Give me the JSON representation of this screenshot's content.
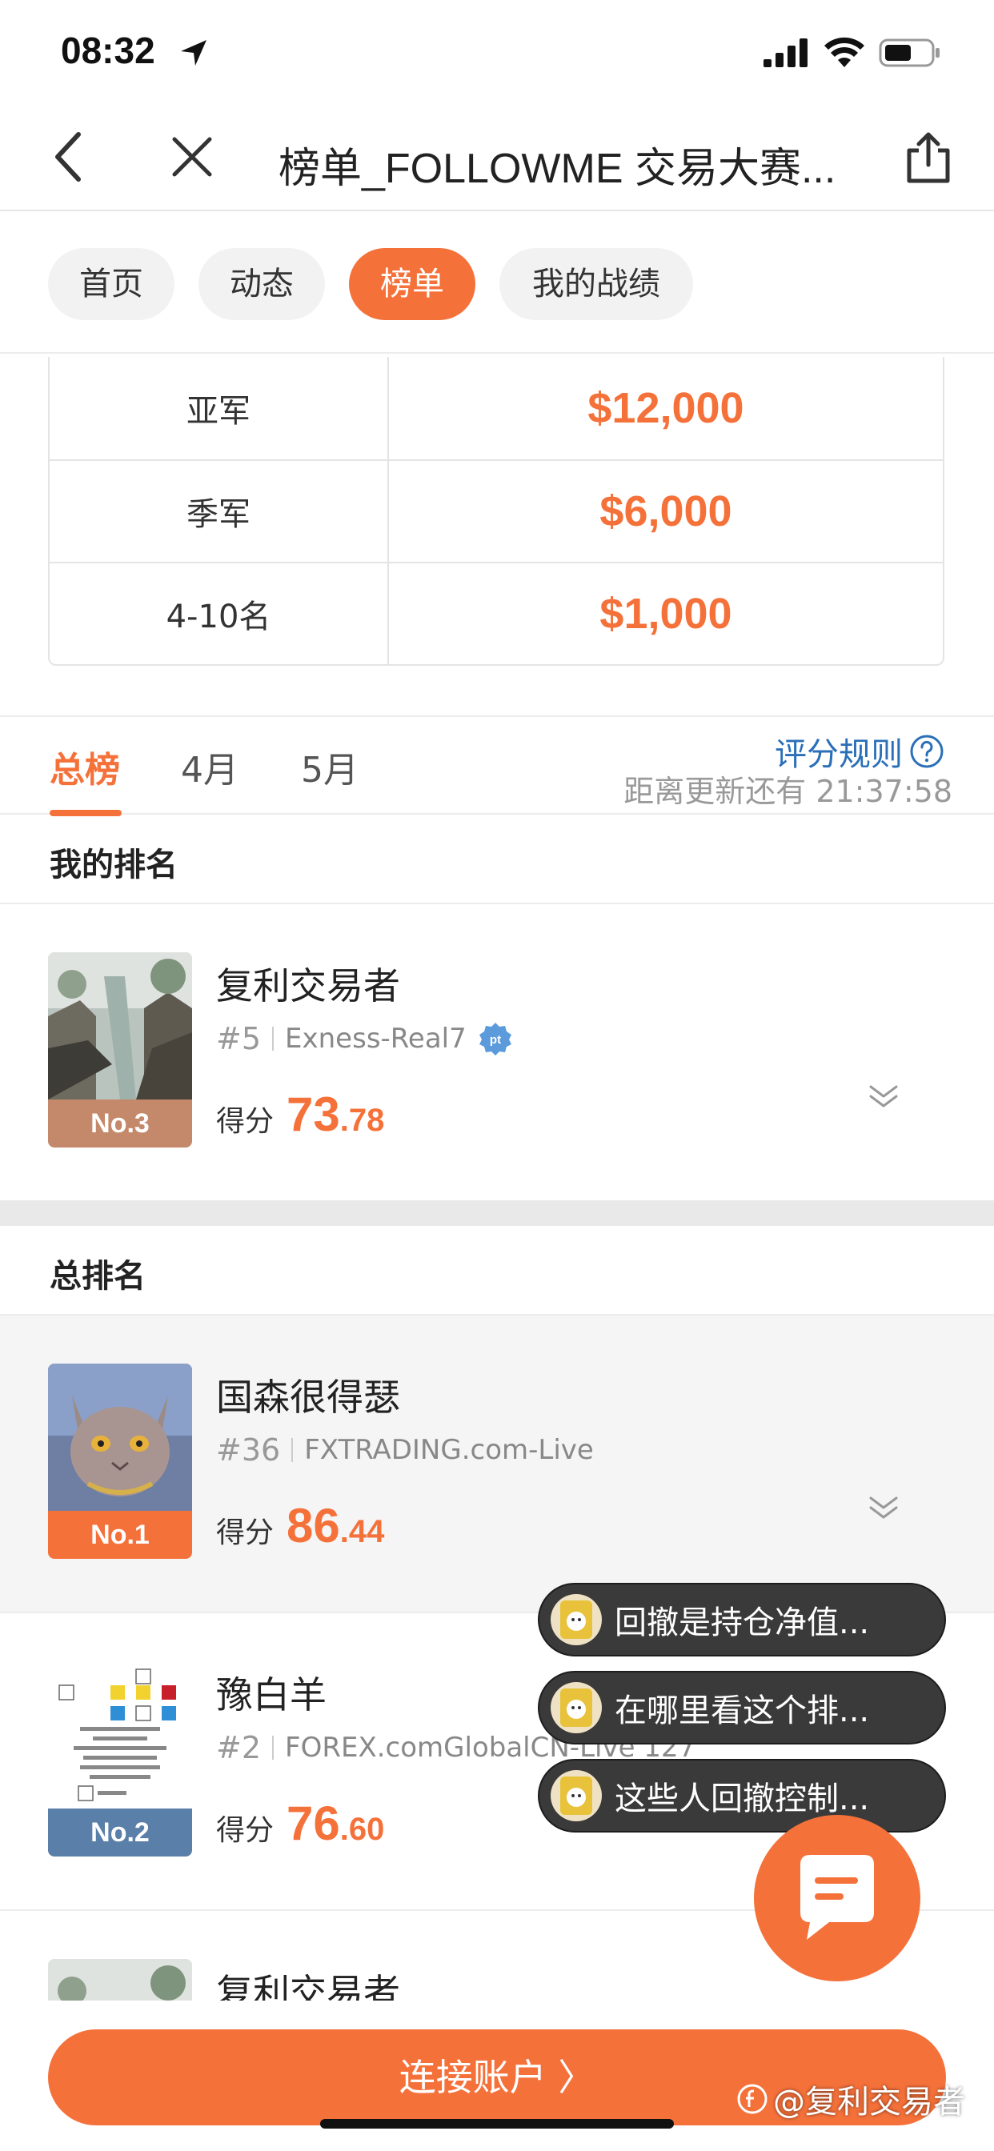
{
  "status_bar": {
    "time": "08:32"
  },
  "nav": {
    "title": "榜单_FOLLOWME 交易大赛..."
  },
  "pill_tabs": [
    {
      "label": "首页"
    },
    {
      "label": "动态"
    },
    {
      "label": "榜单",
      "active": true
    },
    {
      "label": "我的战绩"
    }
  ],
  "prizes": [
    {
      "rank": "亚军",
      "amount": "$12,000"
    },
    {
      "rank": "季军",
      "amount": "$6,000"
    },
    {
      "rank": "4-10名",
      "amount": "$1,000"
    }
  ],
  "rank_tabs": {
    "tabs": [
      {
        "label": "总榜",
        "active": true
      },
      {
        "label": "4月"
      },
      {
        "label": "5月"
      }
    ],
    "rules_label": "评分规则",
    "countdown": "距离更新还有 21:37:58"
  },
  "my_rank": {
    "header": "我的排名",
    "entry": {
      "name": "复利交易者",
      "medal": "No.3",
      "rank": "#5",
      "account": "Exness-Real7",
      "badge": "pt",
      "score_label": "得分",
      "score_int": "73",
      "score_dec": ".78"
    }
  },
  "overall": {
    "header": "总排名",
    "entries": [
      {
        "name": "国森很得瑟",
        "medal": "No.1",
        "rank": "#36",
        "account": "FXTRADING.com-Live",
        "score_label": "得分",
        "score_int": "86",
        "score_dec": ".44"
      },
      {
        "name": "豫白羊",
        "medal": "No.2",
        "rank": "#2",
        "account": "FOREX.comGlobalCN-Live 127",
        "score_label": "得分",
        "score_int": "76",
        "score_dec": ".60"
      },
      {
        "name": "复利交易者"
      }
    ]
  },
  "chat_bubbles": [
    "回撤是持仓净值...",
    "在哪里看这个排...",
    "这些人回撤控制..."
  ],
  "connect_button": "连接账户 〉",
  "watermark": "@复利交易者",
  "colors": {
    "accent": "#f5713a",
    "link": "#2a6fb8"
  }
}
